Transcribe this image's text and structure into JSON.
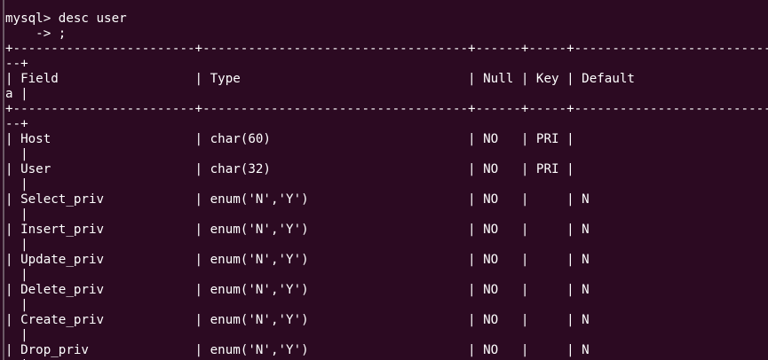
{
  "terminal": {
    "lines": [
      "mysql> desc user",
      "    -> ;",
      "+------------------------+-----------------------------------+------+-----+---------------------------",
      "--+",
      "| Field                  | Type                              | Null | Key | Default",
      "a |",
      "+------------------------+-----------------------------------+------+-----+---------------------------",
      "--+",
      "| Host                   | char(60)                          | NO   | PRI |",
      "  |",
      "| User                   | char(32)                          | NO   | PRI |",
      "  |",
      "| Select_priv            | enum('N','Y')                     | NO   |     | N",
      "  |",
      "| Insert_priv            | enum('N','Y')                     | NO   |     | N",
      "  |",
      "| Update_priv            | enum('N','Y')                     | NO   |     | N",
      "  |",
      "| Delete_priv            | enum('N','Y')                     | NO   |     | N",
      "  |",
      "| Create_priv            | enum('N','Y')                     | NO   |     | N",
      "  |",
      "| Drop_priv              | enum('N','Y')                     | NO   |     | N",
      "  |"
    ]
  },
  "colors": {
    "background": "#2c0a22",
    "text": "#ffffff",
    "border": "#6c5a66"
  }
}
